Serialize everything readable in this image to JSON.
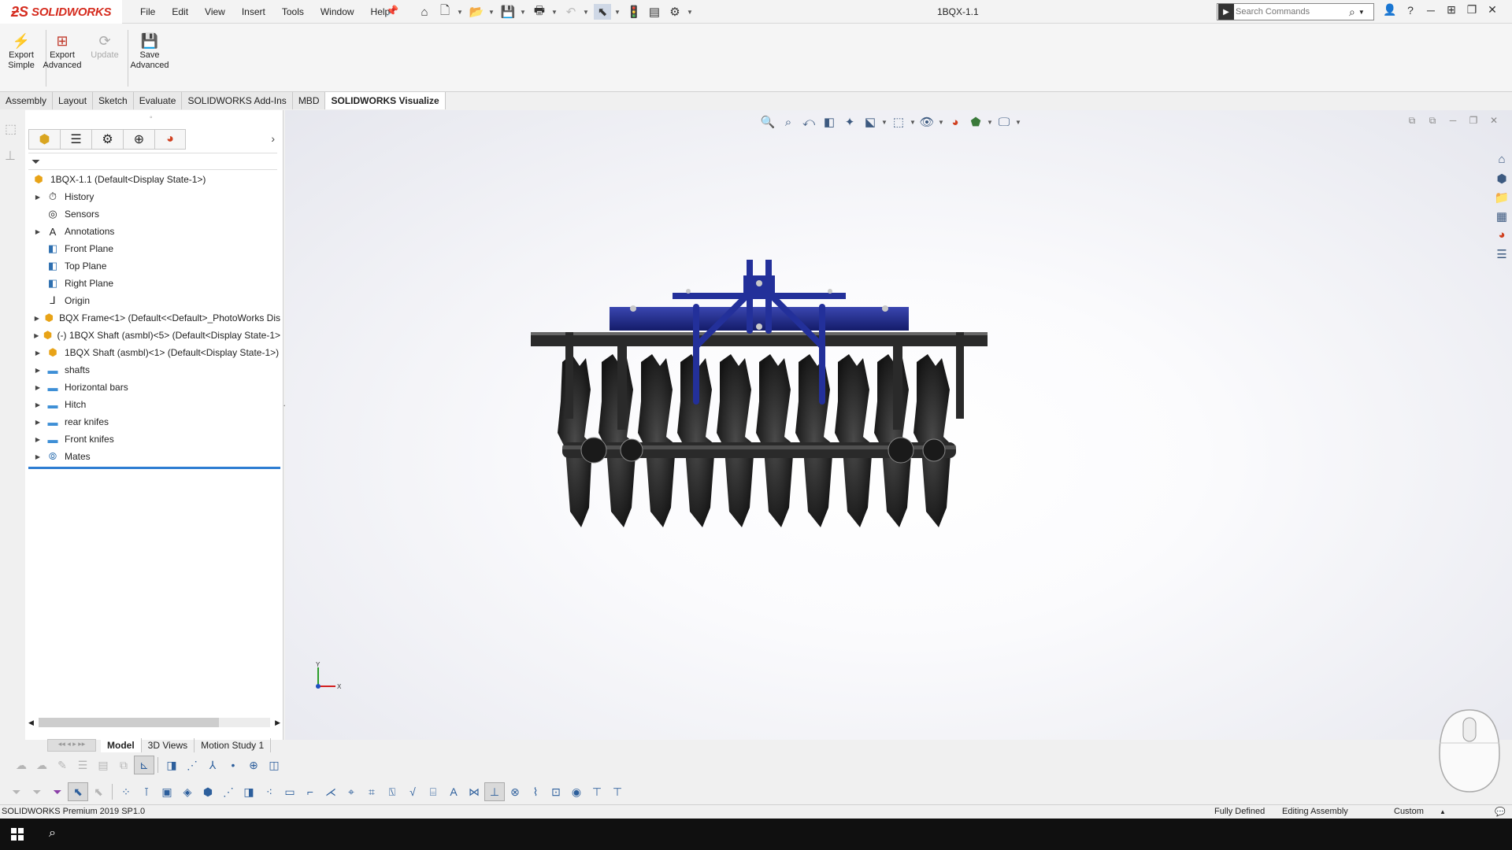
{
  "app": {
    "logo_ds": "ƻS",
    "logo_brand": "SOLIDWORKS",
    "document_title": "1BQX-1.1"
  },
  "menu": [
    "File",
    "Edit",
    "View",
    "Insert",
    "Tools",
    "Window",
    "Help"
  ],
  "search": {
    "placeholder": "Search Commands"
  },
  "command_manager": {
    "export_simple": "Export\nSimple",
    "export_advanced": "Export\nAdvanced",
    "update": "Update",
    "save_advanced": "Save\nAdvanced"
  },
  "tabs": [
    "Assembly",
    "Layout",
    "Sketch",
    "Evaluate",
    "SOLIDWORKS Add-Ins",
    "MBD",
    "SOLIDWORKS Visualize"
  ],
  "active_tab": "SOLIDWORKS Visualize",
  "tree": {
    "root": "1BQX-1.1  (Default<Display State-1>)",
    "items": [
      {
        "label": "History",
        "icon": "history-icon",
        "expandable": true
      },
      {
        "label": "Sensors",
        "icon": "sensors-icon",
        "expandable": false
      },
      {
        "label": "Annotations",
        "icon": "annotations-icon",
        "expandable": true
      },
      {
        "label": "Front Plane",
        "icon": "plane-icon",
        "expandable": false
      },
      {
        "label": "Top Plane",
        "icon": "plane-icon",
        "expandable": false
      },
      {
        "label": "Right Plane",
        "icon": "plane-icon",
        "expandable": false
      },
      {
        "label": "Origin",
        "icon": "origin-icon",
        "expandable": false
      },
      {
        "label": "BQX Frame<1> (Default<<Default>_PhotoWorks Dis",
        "icon": "part-icon",
        "expandable": true
      },
      {
        "label": "(-) 1BQX Shaft (asmbl)<5> (Default<Display State-1>",
        "icon": "subassembly-icon",
        "expandable": true
      },
      {
        "label": "1BQX Shaft (asmbl)<1> (Default<Display State-1>)",
        "icon": "subassembly-icon",
        "expandable": true
      },
      {
        "label": "shafts",
        "icon": "folder-icon",
        "expandable": true
      },
      {
        "label": "Horizontal bars",
        "icon": "folder-icon",
        "expandable": true
      },
      {
        "label": "Hitch",
        "icon": "folder-icon",
        "expandable": true
      },
      {
        "label": "rear knifes",
        "icon": "folder-icon",
        "expandable": true
      },
      {
        "label": "Front knifes",
        "icon": "folder-icon",
        "expandable": true
      },
      {
        "label": "Mates",
        "icon": "mates-icon",
        "expandable": true
      }
    ]
  },
  "bottom_tabs": [
    "Model",
    "3D Views",
    "Motion Study 1"
  ],
  "triad": {
    "x": "X",
    "y": "Y"
  },
  "status": {
    "product": "SOLIDWORKS Premium 2019 SP1.0",
    "state": "Fully Defined",
    "mode": "Editing Assembly",
    "units": "Custom"
  },
  "colors": {
    "accent": "#2d7dd2",
    "brand": "#d52b1e",
    "frame_blue": "#1f2a8a",
    "disc_black": "#1c1c1c"
  }
}
